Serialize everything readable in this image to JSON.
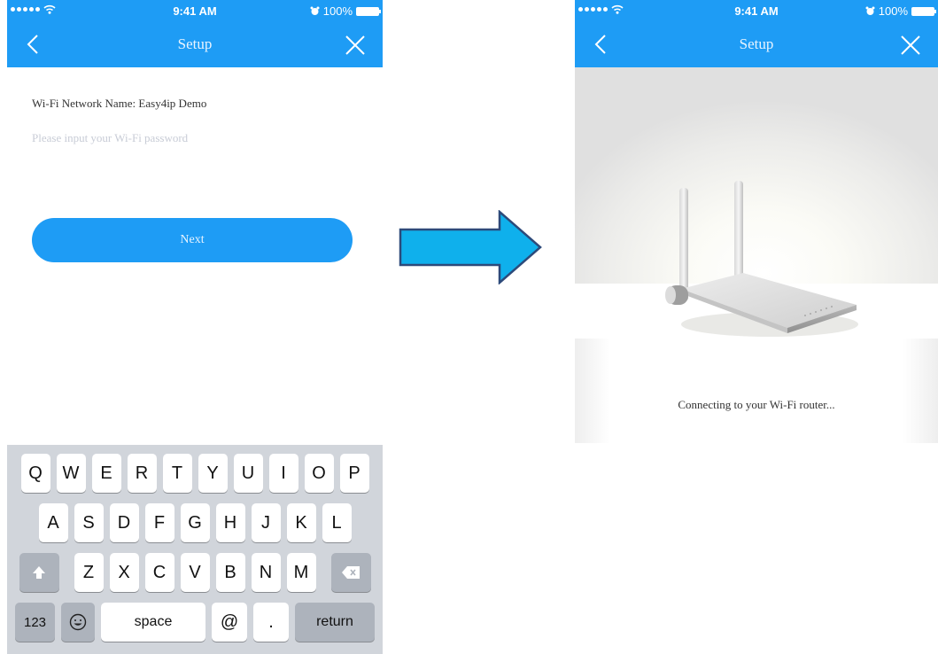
{
  "status_bar": {
    "time": "9:41 AM",
    "battery": "100%"
  },
  "left_screen": {
    "title": "Setup",
    "network_label": "Wi-Fi Network Name: Easy4ip Demo",
    "password_placeholder": "Please input your Wi-Fi password",
    "password_value": "",
    "next_label": "Next"
  },
  "keyboard": {
    "row1": [
      "Q",
      "W",
      "E",
      "R",
      "T",
      "Y",
      "U",
      "I",
      "O",
      "P"
    ],
    "row2": [
      "A",
      "S",
      "D",
      "F",
      "G",
      "H",
      "J",
      "K",
      "L"
    ],
    "row3": [
      "Z",
      "X",
      "C",
      "V",
      "B",
      "N",
      "M"
    ],
    "numbers_label": "123",
    "space_label": "space",
    "at_label": "@",
    "period_label": ".",
    "return_label": "return"
  },
  "right_screen": {
    "title": "Setup",
    "connecting_text": "Connecting to your Wi-Fi router..."
  },
  "colors": {
    "header_blue": "#1e9cf5",
    "arrow_fill": "#0fb0ec",
    "arrow_stroke": "#2d4a7a",
    "keyboard_bg": "#d1d5db"
  },
  "icons": {
    "back": "chevron-left-icon",
    "close": "close-icon",
    "wifi": "wifi-icon",
    "alarm": "alarm-icon",
    "battery": "battery-icon",
    "shift": "shift-icon",
    "backspace": "backspace-icon",
    "emoji": "emoji-icon"
  }
}
